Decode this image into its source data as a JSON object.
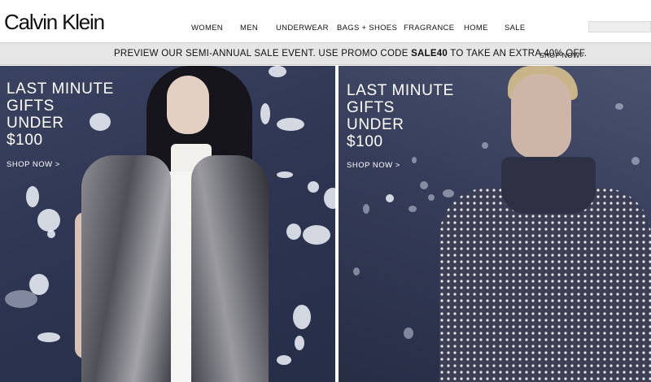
{
  "header": {
    "logo": "Calvin Klein",
    "nav": [
      "WOMEN",
      "MEN",
      "UNDERWEAR",
      "BAGS + SHOES",
      "FRAGRANCE",
      "HOME",
      "SALE"
    ],
    "search": {
      "placeholder": ""
    }
  },
  "promo": {
    "text_before": "PREVIEW OUR SEMI-ANNUAL SALE EVENT. USE PROMO CODE ",
    "code": "SALE40",
    "text_after": " TO TAKE AN EXTRA 40% OFF.",
    "link": "SHOP NOW>"
  },
  "panels": [
    {
      "headline": [
        "LAST MINUTE",
        "GIFTS",
        "UNDER",
        "$100"
      ],
      "cta": "SHOP NOW >"
    },
    {
      "headline": [
        "LAST MINUTE",
        "GIFTS",
        "UNDER",
        "$100"
      ],
      "cta": "SHOP NOW >"
    }
  ],
  "colors": {
    "promo_bg": "#e6e6e6",
    "panel_bg": "#2e3653",
    "text_on_image": "#ffffff"
  }
}
